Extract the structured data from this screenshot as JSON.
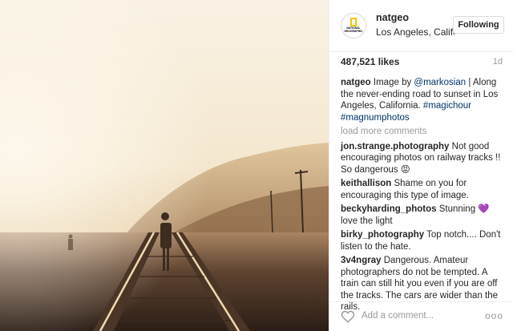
{
  "header": {
    "username": "natgeo",
    "location": "Los Angeles, Califo...",
    "follow_label": "Following",
    "avatar_logo_text": "NATIONAL GEOGRAPHIC"
  },
  "meta": {
    "likes": "487,521 likes",
    "time": "1d"
  },
  "caption": {
    "user": "natgeo",
    "text_before": "Image by ",
    "mention": "@markosian",
    "text_after": " | Along the never-ending road to sunset in Los Angeles, California. ",
    "hashtag1": "#magichour",
    "hashtag2": "#magnumphotos"
  },
  "load_more": "load more comments",
  "comments": [
    {
      "user": "jon.strange.photography",
      "text": "Not good encouraging photos on railway tracks !! So dangerous 😡"
    },
    {
      "user": "keithallison",
      "text": "Shame on you for encouraging this type of image."
    },
    {
      "user": "beckyharding_photos",
      "text": "Stunning 💜 love the light"
    },
    {
      "user": "birky_photography",
      "text": "Top notch.... Don't listen to the hate."
    },
    {
      "user": "3v4ngray",
      "text": "Dangerous. Amateur photographers do not be tempted. A train can still hit you even if you are off the tracks. The cars are wider than the rails."
    }
  ],
  "footer": {
    "add_comment_placeholder": "Add a comment...",
    "more_label": "ooo",
    "heart_icon": "heart-outline-icon"
  },
  "colors": {
    "link": "#003569",
    "muted": "#999999",
    "border": "#efefef"
  }
}
